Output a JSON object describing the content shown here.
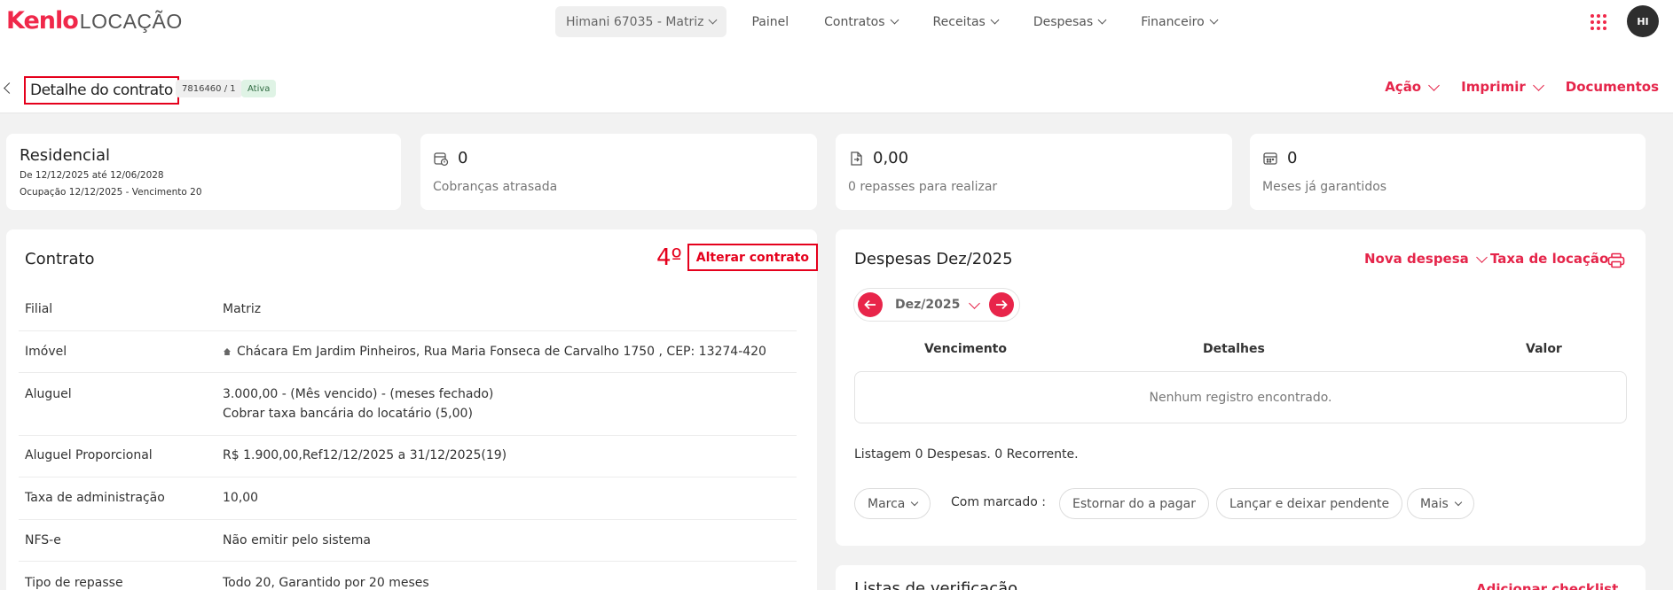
{
  "brand": {
    "name": "Kenlo",
    "product": "LOCAÇÃO"
  },
  "nav": {
    "account": "Himani 67035 - Matriz",
    "items": [
      "Painel",
      "Contratos",
      "Receitas",
      "Despesas",
      "Financeiro"
    ]
  },
  "user": {
    "initials": "HI"
  },
  "page": {
    "title": "Detalhe do contrato",
    "contract_id": "7816460 / 1",
    "status": "Ativa",
    "actions": [
      "Ação",
      "Imprimir",
      "Documentos"
    ]
  },
  "summary": {
    "type": "Residencial",
    "period": "De 12/12/2025 até 12/06/2028",
    "occupation": "Ocupação 12/12/2025 - Vencimento 20",
    "late_charges": {
      "value": "0",
      "label": "Cobranças atrasada",
      "icon": "calendar-alert-icon"
    },
    "transfers": {
      "value": "0,00",
      "label": "0 repasses para realizar",
      "icon": "money-transfer-icon"
    },
    "guaranteed": {
      "value": "0",
      "label": "Meses já garantidos",
      "icon": "calculator-icon"
    }
  },
  "contract": {
    "title": "Contrato",
    "annotation": "4º",
    "edit_label": "Alterar contrato",
    "rows": [
      {
        "label": "Filial",
        "value": "Matriz"
      },
      {
        "label": "Imóvel",
        "value": "Chácara Em Jardim Pinheiros, Rua Maria Fonseca de Carvalho 1750 , CEP: 13274-420"
      },
      {
        "label": "Aluguel",
        "value": "3.000,00 - (Mês vencido) - (meses fechado)",
        "value2": "Cobrar taxa bancária do locatário (5,00)"
      },
      {
        "label": "Aluguel Proporcional",
        "value": "R$ 1.900,00,Ref12/12/2025 a 31/12/2025(19)"
      },
      {
        "label": "Taxa de administração",
        "value": "10,00"
      },
      {
        "label": "NFS-e",
        "value": "Não emitir pelo sistema"
      },
      {
        "label": "Tipo de repasse",
        "value": "Todo 20, Garantido por 20 meses"
      }
    ]
  },
  "expenses": {
    "title": "Despesas Dez/2025",
    "new_label": "Nova despesa",
    "fee_label": "Taxa de locação",
    "month": "Dez/2025",
    "columns": [
      "Vencimento",
      "Detalhes",
      "Valor"
    ],
    "empty": "Nenhum registro encontrado.",
    "summary": "Listagem 0 Despesas. 0 Recorrente.",
    "mark_label": "Marca",
    "with_marked": "Com marcado :",
    "reverse_label": "Estornar do a pagar",
    "pending_label": "Lançar e deixar pendente",
    "more_label": "Mais"
  },
  "checklists": {
    "title": "Listas de verificação",
    "add_label": "Adicionar checklist"
  },
  "colors": {
    "accent": "#e8254a",
    "annotation": "#e5001c"
  }
}
